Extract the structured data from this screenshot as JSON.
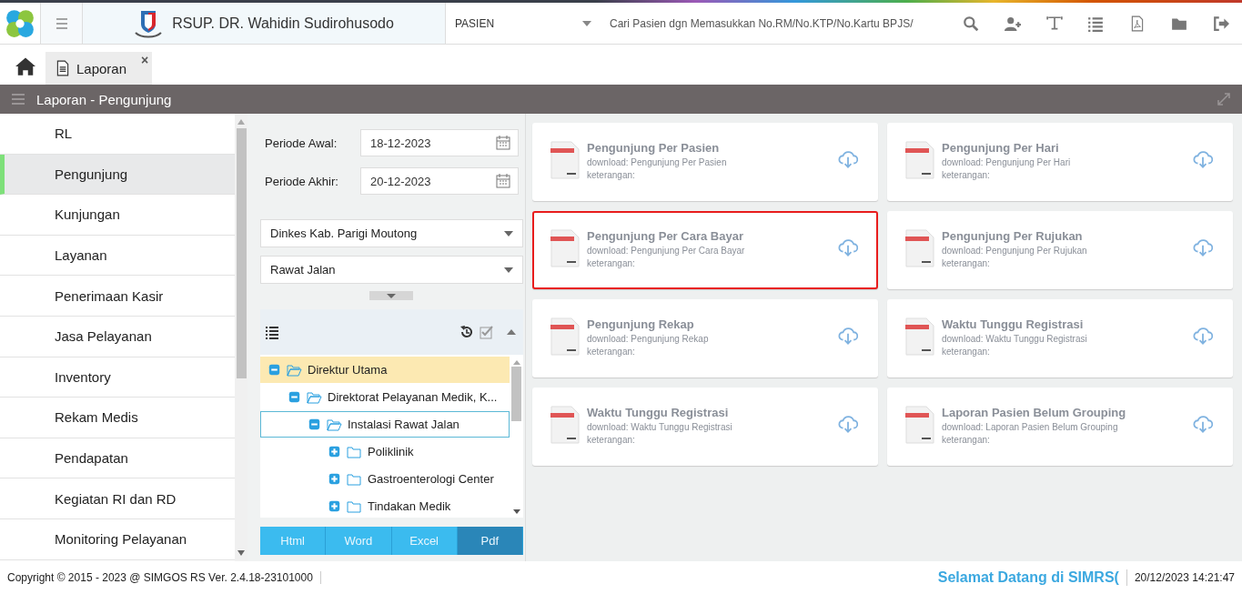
{
  "header": {
    "hospital_name": "RSUP. DR. Wahidin Sudirohusodo",
    "category_select": "PASIEN",
    "search": {
      "placeholder": "Cari Pasien dgn Memasukkan No.RM/No.KTP/No.Kartu BPJS/"
    }
  },
  "tabs": [
    {
      "label": "Laporan",
      "close": "×",
      "selected": true
    }
  ],
  "section_bar": {
    "title": "Laporan - Pengunjung"
  },
  "sidebar": {
    "items": [
      {
        "label": "RL",
        "selected": false
      },
      {
        "label": "Pengunjung",
        "selected": true
      },
      {
        "label": "Kunjungan",
        "selected": false
      },
      {
        "label": "Layanan",
        "selected": false
      },
      {
        "label": "Penerimaan Kasir",
        "selected": false
      },
      {
        "label": "Jasa Pelayanan",
        "selected": false
      },
      {
        "label": "Inventory",
        "selected": false
      },
      {
        "label": "Rekam Medis",
        "selected": false
      },
      {
        "label": "Pendapatan",
        "selected": false
      },
      {
        "label": "Kegiatan RI dan RD",
        "selected": false
      },
      {
        "label": "Monitoring Pelayanan",
        "selected": false
      }
    ]
  },
  "filters": {
    "periode_awal": {
      "label": "Periode Awal:",
      "value": "18-12-2023"
    },
    "periode_akhir": {
      "label": "Periode Akhir:",
      "value": "20-12-2023"
    },
    "instansi_select": "Dinkes Kab. Parigi Moutong",
    "jenis_select": "Rawat Jalan"
  },
  "tree": [
    {
      "label": "Direktur Utama",
      "expanded": true,
      "selected": true,
      "focused": false,
      "children": [
        {
          "label": "Direktorat Pelayanan Medik, K...",
          "expanded": true,
          "selected": false,
          "focused": false,
          "children": [
            {
              "label": "Instalasi Rawat Jalan",
              "expanded": true,
              "selected": false,
              "focused": true,
              "children": [
                {
                  "label": "Poliklinik",
                  "expanded": false,
                  "selected": false,
                  "focused": false
                },
                {
                  "label": "Gastroenterologi Center",
                  "expanded": false,
                  "selected": false,
                  "focused": false
                },
                {
                  "label": "Tindakan Medik",
                  "expanded": false,
                  "selected": false,
                  "focused": false
                }
              ]
            }
          ]
        }
      ]
    }
  ],
  "export_buttons": [
    {
      "label": "Html",
      "selected": false
    },
    {
      "label": "Word",
      "selected": false
    },
    {
      "label": "Excel",
      "selected": false
    },
    {
      "label": "Pdf",
      "selected": true
    }
  ],
  "reports": [
    {
      "title": "Pengunjung Per Pasien",
      "download": "download: Pengunjung Per Pasien",
      "note": "keterangan:",
      "highlighted": false
    },
    {
      "title": "Pengunjung Per Hari",
      "download": "download: Pengunjung Per Hari",
      "note": "keterangan:",
      "highlighted": false
    },
    {
      "title": "Pengunjung Per Cara Bayar",
      "download": "download: Pengunjung Per Cara Bayar",
      "note": "keterangan:",
      "highlighted": true
    },
    {
      "title": "Pengunjung Per Rujukan",
      "download": "download: Pengunjung Per Rujukan",
      "note": "keterangan:",
      "highlighted": false
    },
    {
      "title": "Pengunjung Rekap",
      "download": "download: Pengunjung Rekap",
      "note": "keterangan:",
      "highlighted": false
    },
    {
      "title": "Waktu Tunggu Registrasi",
      "download": "download: Waktu Tunggu Registrasi",
      "note": "keterangan:",
      "highlighted": false
    },
    {
      "title": "Waktu Tunggu Registrasi",
      "download": "download: Waktu Tunggu Registrasi",
      "note": "keterangan:",
      "highlighted": false
    },
    {
      "title": "Laporan Pasien Belum Grouping",
      "download": "download: Laporan Pasien Belum Grouping",
      "note": "keterangan:",
      "highlighted": false
    }
  ],
  "footer": {
    "copyright": "Copyright © 2015 - 2023 @ SIMGOS RS Ver. 2.4.18-23101000",
    "welcome": "Selamat Datang di SIMRS(",
    "datetime": "20/12/2023 14:21:47"
  }
}
